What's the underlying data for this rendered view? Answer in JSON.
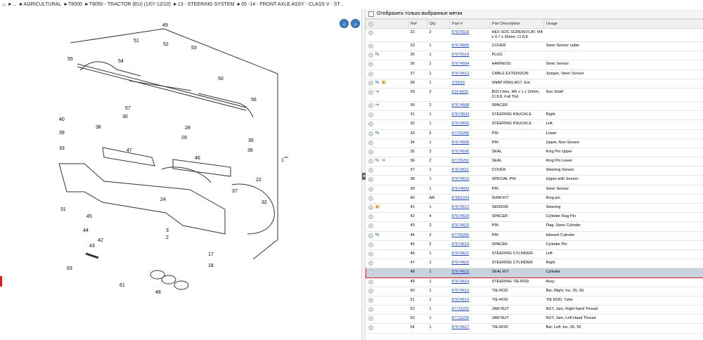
{
  "breadcrumb": {
    "home_icon": "home-icon",
    "items": [
      "►...",
      "►AGRICULTURAL",
      "►T8000",
      "►T8050 - TRACTOR (EU) (1/07-12/10)",
      "►13 - STEERING SYSTEM",
      "►05 -14 - FRONT AXLE ASSY - CLASS V - ST..."
    ]
  },
  "filter": {
    "label": "Отобразить только выбранные метки"
  },
  "table": {
    "headers": [
      "Ref",
      "Qty",
      "Part #",
      "Part Description",
      "Usage"
    ],
    "rows": [
      {
        "icons": [],
        "ref": "22",
        "qty": "2",
        "part": "87675518",
        "desc": "HEX SOC SCREW,FLAT, M4 x 0.7 x 35mm, Cl 8.8",
        "usage": ""
      },
      {
        "icons": [],
        "ref": "23",
        "qty": "1",
        "part": "87674585",
        "desc": "COVER",
        "usage": "Steer Sensor cable"
      },
      {
        "icons": [
          "swap"
        ],
        "ref": "25",
        "qty": "1",
        "part": "87675519",
        "desc": "PLUG",
        "usage": ""
      },
      {
        "icons": [],
        "ref": "26",
        "qty": "1",
        "part": "87674584",
        "desc": "HARNESS",
        "usage": "Steer Sensor"
      },
      {
        "icons": [],
        "ref": "27",
        "qty": "1",
        "part": "87674613",
        "desc": "CABLE EXTENSION",
        "usage": "Jumper, Steer Sensor"
      },
      {
        "icons": [
          "swap",
          "box"
        ],
        "ref": "28",
        "qty": "1",
        "part": "370016",
        "desc": "SNAP RING,M17, Ext",
        "usage": ""
      },
      {
        "icons": [
          "right"
        ],
        "ref": "29",
        "qty": "2",
        "part": "614-6010",
        "desc": "BOLT,Hex, M6 x 1 x 10mm, Cl 8.8, Full Thd",
        "usage": "Sun Shaft"
      },
      {
        "icons": [
          "right"
        ],
        "ref": "30",
        "qty": "2",
        "part": "87674588",
        "desc": "SPACER",
        "usage": ""
      },
      {
        "icons": [],
        "ref": "31",
        "qty": "1",
        "part": "87674593",
        "desc": "STEERING KNUCKLE",
        "usage": "Right"
      },
      {
        "icons": [],
        "ref": "32",
        "qty": "1",
        "part": "87674592",
        "desc": "STEERING KNUCKLE",
        "usage": "Left"
      },
      {
        "icons": [
          "swap"
        ],
        "ref": "33",
        "qty": "2",
        "part": "87725290",
        "desc": "PIN",
        "usage": "Lower"
      },
      {
        "icons": [],
        "ref": "34",
        "qty": "1",
        "part": "87674589",
        "desc": "PIN",
        "usage": "Upper, Non-Sensor"
      },
      {
        "icons": [],
        "ref": "35",
        "qty": "2",
        "part": "87674590",
        "desc": "SEAL",
        "usage": "King Pin Upper"
      },
      {
        "icons": [
          "swap",
          "right"
        ],
        "ref": "36",
        "qty": "2",
        "part": "87725291",
        "desc": "SEAL",
        "usage": "King Pin Lower"
      },
      {
        "icons": [],
        "ref": "37",
        "qty": "1",
        "part": "87674611",
        "desc": "COVER",
        "usage": "Steering Sensor"
      },
      {
        "icons": [],
        "ref": "38",
        "qty": "1",
        "part": "87674610",
        "desc": "SPECIAL PIN",
        "usage": "Upper with Sensor"
      },
      {
        "icons": [],
        "ref": "39",
        "qty": "1",
        "part": "87674609",
        "desc": "PIN",
        "usage": "Steer Sensor"
      },
      {
        "icons": [],
        "ref": "40",
        "qty": "AR",
        "part": "87681224",
        "desc": "SHIM KIT",
        "usage": "King pin"
      },
      {
        "icons": [
          "box"
        ],
        "ref": "41",
        "qty": "1",
        "part": "87674612",
        "desc": "SENSOR",
        "usage": "Steering"
      },
      {
        "icons": [],
        "ref": "42",
        "qty": "4",
        "part": "87674624",
        "desc": "SPACER",
        "usage": "Cylinder Flag Pin"
      },
      {
        "icons": [],
        "ref": "43",
        "qty": "2",
        "part": "87674623",
        "desc": "PIN",
        "usage": "Flag, Steer Cylinder"
      },
      {
        "icons": [
          "swap"
        ],
        "ref": "44",
        "qty": "2",
        "part": "87725296",
        "desc": "PIN",
        "usage": "Inboard Cylinder"
      },
      {
        "icons": [],
        "ref": "45",
        "qty": "2",
        "part": "87674619",
        "desc": "SPACER",
        "usage": "Cylinder Pin"
      },
      {
        "icons": [],
        "ref": "46",
        "qty": "1",
        "part": "87674621",
        "desc": "STEERING CYLINDER",
        "usage": "Left"
      },
      {
        "icons": [],
        "ref": "47",
        "qty": "1",
        "part": "87674620",
        "desc": "STEERING CYLINDER",
        "usage": "Right"
      },
      {
        "icons": [],
        "ref": "48",
        "qty": "1",
        "part": "87674622",
        "desc": "SEAL KIT",
        "usage": "Cylinder",
        "selected": true
      },
      {
        "icons": [],
        "ref": "49",
        "qty": "1",
        "part": "87674614",
        "desc": "STEERING TIE-ROD",
        "usage": "Assy"
      },
      {
        "icons": [],
        "ref": "50",
        "qty": "1",
        "part": "87674615",
        "desc": "TIE-ROD",
        "usage": "Bar, Right, Inc. 55, 56"
      },
      {
        "icons": [],
        "ref": "51",
        "qty": "1",
        "part": "87674616",
        "desc": "TIE-ROD",
        "usage": "TIE ROD, Tube"
      },
      {
        "icons": [],
        "ref": "52",
        "qty": "1",
        "part": "87715231",
        "desc": "JAM NUT",
        "usage": "NUT, Jam, Right hand Thread"
      },
      {
        "icons": [],
        "ref": "53",
        "qty": "1",
        "part": "87715230",
        "desc": "JAM NUT",
        "usage": "NUT, Jam, Left Hand Thread"
      },
      {
        "icons": [],
        "ref": "54",
        "qty": "1",
        "part": "87674617",
        "desc": "TIE-ROD",
        "usage": "Bar, Left, Inc. 55, 56"
      }
    ]
  },
  "diagram": {
    "labels": [
      "49",
      "51",
      "52",
      "53",
      "50",
      "55",
      "54",
      "56",
      "57",
      "40",
      "39",
      "38",
      "36",
      "35",
      "33",
      "31",
      "32",
      "24",
      "22",
      "3",
      "45",
      "44",
      "43",
      "42",
      "47",
      "48",
      "46",
      "37",
      "63",
      "61",
      "1",
      "2",
      "17",
      "18",
      "28",
      "29",
      "30"
    ]
  }
}
